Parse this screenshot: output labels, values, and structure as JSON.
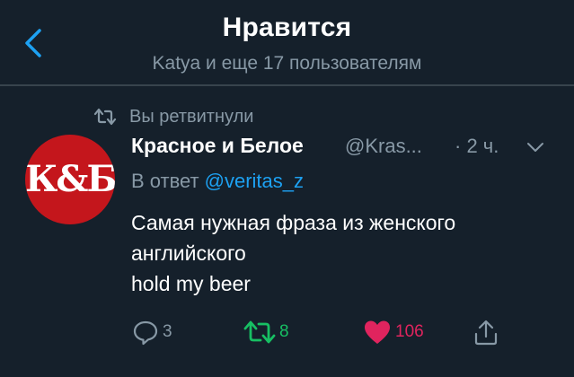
{
  "header": {
    "title": "Нравится",
    "subtitle": "Katya и еще 17 пользователям"
  },
  "retweet_notice": "Вы ретвитнули",
  "tweet": {
    "author_name": "Красное и Белое",
    "author_handle": "@Kras...",
    "time": "· 2 ч.",
    "reply_to_label": "В ответ",
    "reply_to_handle": "@veritas_z",
    "text_lines": [
      "Самая нужная фраза из женского",
      "английского",
      "hold my beer"
    ],
    "avatar_text": "К&Б",
    "replies": "3",
    "retweets": "8",
    "likes": "106"
  },
  "icons": {
    "back": "chevron-left-icon",
    "retweeted": "retweet-icon",
    "menu": "chevron-down-icon",
    "reply": "reply-icon",
    "retweet": "retweet-icon",
    "like": "heart-icon",
    "share": "share-icon"
  },
  "colors": {
    "background": "#15202b",
    "accent": "#1da1f2",
    "secondary_text": "#8899a6",
    "retweet_active": "#17bf63",
    "like_active": "#e0245e",
    "divider": "#38444d",
    "avatar_bg": "#c4161c"
  }
}
